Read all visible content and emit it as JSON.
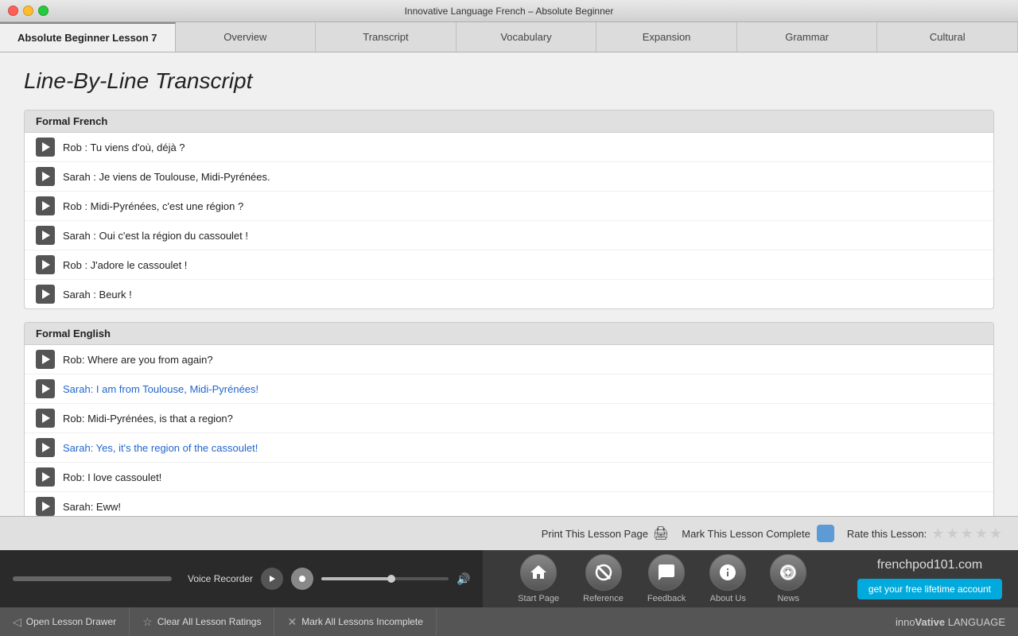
{
  "window": {
    "title": "Innovative Language French – Absolute Beginner"
  },
  "tabs": {
    "active": "Absolute Beginner Lesson 7",
    "items": [
      "Overview",
      "Transcript",
      "Vocabulary",
      "Expansion",
      "Grammar",
      "Cultural"
    ]
  },
  "page": {
    "title": "Line-By-Line Transcript"
  },
  "french_section": {
    "header": "Formal French",
    "lines": [
      "Rob : Tu viens d'où, déjà ?",
      "Sarah : Je viens de Toulouse, Midi-Pyrénées.",
      "Rob : Midi-Pyrénées, c'est une région ?",
      "Sarah : Oui c'est la région du cassoulet !",
      "Rob : J'adore le cassoulet !",
      "Sarah : Beurk !"
    ]
  },
  "english_section": {
    "header": "Formal English",
    "lines": [
      "Rob: Where are you from again?",
      "Sarah: I am from Toulouse, Midi-Pyrénées!",
      "Rob: Midi-Pyrénées, is that a region?",
      "Sarah: Yes, it's the region of the cassoulet!",
      "Rob: I love cassoulet!",
      "Sarah: Eww!"
    ]
  },
  "status_bar": {
    "print_label": "Print This Lesson Page",
    "mark_complete_label": "Mark This Lesson Complete",
    "rate_label": "Rate this Lesson:"
  },
  "voice_recorder": {
    "label": "Voice Recorder"
  },
  "nav_icons": [
    {
      "name": "start-page",
      "label": "Start Page",
      "icon": "🏠"
    },
    {
      "name": "reference",
      "label": "Reference",
      "icon": "🚫"
    },
    {
      "name": "feedback",
      "label": "Feedback",
      "icon": "💬"
    },
    {
      "name": "about-us",
      "label": "About Us",
      "icon": "ℹ️"
    },
    {
      "name": "news",
      "label": "News",
      "icon": "📡"
    }
  ],
  "brand": {
    "name": "frenchpod101.com",
    "cta": "get your free lifetime account"
  },
  "action_bar": {
    "open_drawer": "Open Lesson Drawer",
    "clear_ratings": "Clear All Lesson Ratings",
    "mark_incomplete": "Mark All Lessons Incomplete",
    "logo": "innoVative LANGUAGE"
  }
}
